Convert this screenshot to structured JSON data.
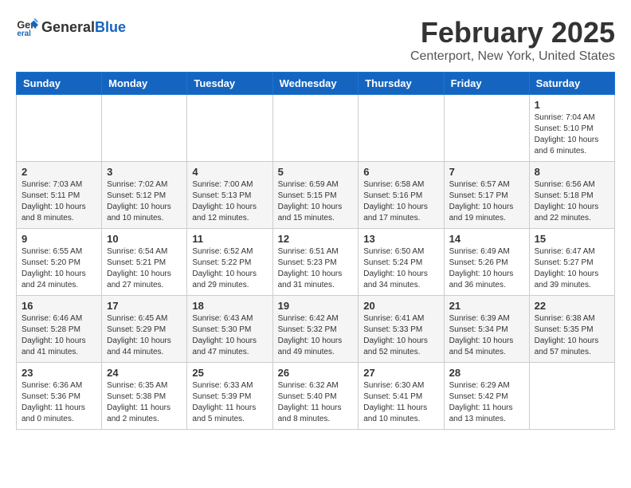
{
  "header": {
    "logo_general": "General",
    "logo_blue": "Blue",
    "month_year": "February 2025",
    "location": "Centerport, New York, United States"
  },
  "weekdays": [
    "Sunday",
    "Monday",
    "Tuesday",
    "Wednesday",
    "Thursday",
    "Friday",
    "Saturday"
  ],
  "weeks": [
    [
      {
        "day": "",
        "info": ""
      },
      {
        "day": "",
        "info": ""
      },
      {
        "day": "",
        "info": ""
      },
      {
        "day": "",
        "info": ""
      },
      {
        "day": "",
        "info": ""
      },
      {
        "day": "",
        "info": ""
      },
      {
        "day": "1",
        "info": "Sunrise: 7:04 AM\nSunset: 5:10 PM\nDaylight: 10 hours and 6 minutes."
      }
    ],
    [
      {
        "day": "2",
        "info": "Sunrise: 7:03 AM\nSunset: 5:11 PM\nDaylight: 10 hours and 8 minutes."
      },
      {
        "day": "3",
        "info": "Sunrise: 7:02 AM\nSunset: 5:12 PM\nDaylight: 10 hours and 10 minutes."
      },
      {
        "day": "4",
        "info": "Sunrise: 7:00 AM\nSunset: 5:13 PM\nDaylight: 10 hours and 12 minutes."
      },
      {
        "day": "5",
        "info": "Sunrise: 6:59 AM\nSunset: 5:15 PM\nDaylight: 10 hours and 15 minutes."
      },
      {
        "day": "6",
        "info": "Sunrise: 6:58 AM\nSunset: 5:16 PM\nDaylight: 10 hours and 17 minutes."
      },
      {
        "day": "7",
        "info": "Sunrise: 6:57 AM\nSunset: 5:17 PM\nDaylight: 10 hours and 19 minutes."
      },
      {
        "day": "8",
        "info": "Sunrise: 6:56 AM\nSunset: 5:18 PM\nDaylight: 10 hours and 22 minutes."
      }
    ],
    [
      {
        "day": "9",
        "info": "Sunrise: 6:55 AM\nSunset: 5:20 PM\nDaylight: 10 hours and 24 minutes."
      },
      {
        "day": "10",
        "info": "Sunrise: 6:54 AM\nSunset: 5:21 PM\nDaylight: 10 hours and 27 minutes."
      },
      {
        "day": "11",
        "info": "Sunrise: 6:52 AM\nSunset: 5:22 PM\nDaylight: 10 hours and 29 minutes."
      },
      {
        "day": "12",
        "info": "Sunrise: 6:51 AM\nSunset: 5:23 PM\nDaylight: 10 hours and 31 minutes."
      },
      {
        "day": "13",
        "info": "Sunrise: 6:50 AM\nSunset: 5:24 PM\nDaylight: 10 hours and 34 minutes."
      },
      {
        "day": "14",
        "info": "Sunrise: 6:49 AM\nSunset: 5:26 PM\nDaylight: 10 hours and 36 minutes."
      },
      {
        "day": "15",
        "info": "Sunrise: 6:47 AM\nSunset: 5:27 PM\nDaylight: 10 hours and 39 minutes."
      }
    ],
    [
      {
        "day": "16",
        "info": "Sunrise: 6:46 AM\nSunset: 5:28 PM\nDaylight: 10 hours and 41 minutes."
      },
      {
        "day": "17",
        "info": "Sunrise: 6:45 AM\nSunset: 5:29 PM\nDaylight: 10 hours and 44 minutes."
      },
      {
        "day": "18",
        "info": "Sunrise: 6:43 AM\nSunset: 5:30 PM\nDaylight: 10 hours and 47 minutes."
      },
      {
        "day": "19",
        "info": "Sunrise: 6:42 AM\nSunset: 5:32 PM\nDaylight: 10 hours and 49 minutes."
      },
      {
        "day": "20",
        "info": "Sunrise: 6:41 AM\nSunset: 5:33 PM\nDaylight: 10 hours and 52 minutes."
      },
      {
        "day": "21",
        "info": "Sunrise: 6:39 AM\nSunset: 5:34 PM\nDaylight: 10 hours and 54 minutes."
      },
      {
        "day": "22",
        "info": "Sunrise: 6:38 AM\nSunset: 5:35 PM\nDaylight: 10 hours and 57 minutes."
      }
    ],
    [
      {
        "day": "23",
        "info": "Sunrise: 6:36 AM\nSunset: 5:36 PM\nDaylight: 11 hours and 0 minutes."
      },
      {
        "day": "24",
        "info": "Sunrise: 6:35 AM\nSunset: 5:38 PM\nDaylight: 11 hours and 2 minutes."
      },
      {
        "day": "25",
        "info": "Sunrise: 6:33 AM\nSunset: 5:39 PM\nDaylight: 11 hours and 5 minutes."
      },
      {
        "day": "26",
        "info": "Sunrise: 6:32 AM\nSunset: 5:40 PM\nDaylight: 11 hours and 8 minutes."
      },
      {
        "day": "27",
        "info": "Sunrise: 6:30 AM\nSunset: 5:41 PM\nDaylight: 11 hours and 10 minutes."
      },
      {
        "day": "28",
        "info": "Sunrise: 6:29 AM\nSunset: 5:42 PM\nDaylight: 11 hours and 13 minutes."
      },
      {
        "day": "",
        "info": ""
      }
    ]
  ]
}
